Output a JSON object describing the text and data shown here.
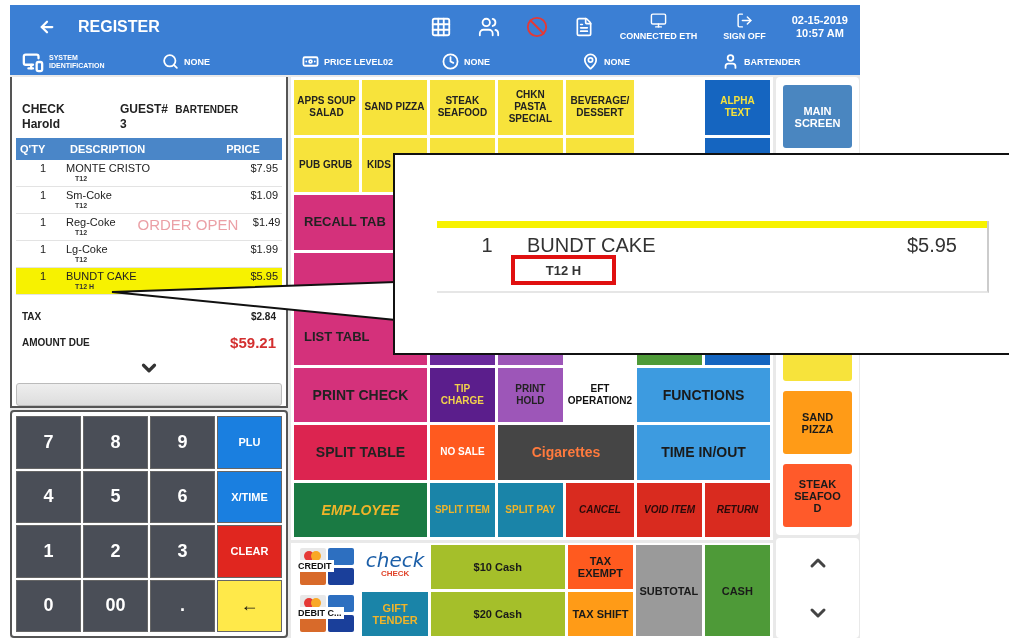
{
  "header": {
    "title": "REGISTER",
    "connection": "CONNECTED ETH",
    "sign_off": "SIGN OFF",
    "date": "02-15-2019",
    "time": "10:57 AM"
  },
  "info_bar": [
    {
      "kind": "system",
      "label": "SYSTEM IDENTIFICATION"
    },
    {
      "kind": "search",
      "label": "NONE"
    },
    {
      "kind": "price",
      "label": "PRICE LEVEL02"
    },
    {
      "kind": "clock",
      "label": "NONE"
    },
    {
      "kind": "location",
      "label": "NONE"
    },
    {
      "kind": "user",
      "label": "BARTENDER"
    }
  ],
  "check": {
    "check_label": "CHECK",
    "check_name": "Harold",
    "guest_label": "GUEST#",
    "guest_value": "3",
    "server": "BARTENDER"
  },
  "order": {
    "columns": [
      "Q'TY",
      "DESCRIPTION",
      "PRICE"
    ],
    "watermark": "ORDER OPEN",
    "rows": [
      {
        "qty": "1",
        "description": "MONTE CRISTO",
        "seat": "T12",
        "price": "$7.95",
        "selected": false
      },
      {
        "qty": "1",
        "description": "Sm-Coke",
        "seat": "T12",
        "price": "$1.09",
        "selected": false
      },
      {
        "qty": "1",
        "description": "Reg-Coke",
        "seat": "T12",
        "price": "$1.49",
        "selected": false
      },
      {
        "qty": "1",
        "description": "Lg-Coke",
        "seat": "T12",
        "price": "$1.99",
        "selected": false
      },
      {
        "qty": "1",
        "description": "BUNDT CAKE",
        "seat": "T12 H",
        "price": "$5.95",
        "selected": true
      }
    ]
  },
  "totals": {
    "tax_label": "TAX",
    "tax": "$2.84",
    "due_label": "AMOUNT DUE",
    "due": "$59.21"
  },
  "keypad": [
    {
      "kind": "digit",
      "label": "7"
    },
    {
      "kind": "digit",
      "label": "8"
    },
    {
      "kind": "digit",
      "label": "9"
    },
    {
      "kind": "function",
      "label": "PLU"
    },
    {
      "kind": "digit",
      "label": "4"
    },
    {
      "kind": "digit",
      "label": "5"
    },
    {
      "kind": "digit",
      "label": "6"
    },
    {
      "kind": "function",
      "label": "X/TIME"
    },
    {
      "kind": "digit",
      "label": "1"
    },
    {
      "kind": "digit",
      "label": "2"
    },
    {
      "kind": "digit",
      "label": "3"
    },
    {
      "kind": "clear",
      "label": "CLEAR"
    },
    {
      "kind": "digit",
      "label": "0"
    },
    {
      "kind": "digit",
      "label": "00"
    },
    {
      "kind": "digit",
      "label": "."
    },
    {
      "kind": "enter",
      "label": "←"
    }
  ],
  "menu_buttons": [
    {
      "kind": "key",
      "label": "APPS SOUP SALAD",
      "color": "#f7e33b",
      "wide": false
    },
    {
      "kind": "key",
      "label": "SAND PIZZA",
      "color": "#f7e33b",
      "wide": false
    },
    {
      "kind": "key",
      "label": "STEAK SEAFOOD",
      "color": "#f7e33b",
      "wide": false
    },
    {
      "kind": "key",
      "label": "CHKN PASTA SPECIAL",
      "color": "#f7e33b",
      "wide": false
    },
    {
      "kind": "key",
      "label": "BEVERAGE/ DESSERT",
      "color": "#f7e33b",
      "wide": false
    },
    {
      "kind": "empty"
    },
    {
      "kind": "key",
      "label": "ALPHA TEXT",
      "color": "#1565c0",
      "wide": false
    },
    {
      "kind": "key",
      "label": "PUB GRUB",
      "color": "#f7e33b",
      "wide": false
    },
    {
      "kind": "key",
      "label": "KIDS",
      "color": "#f7e33b",
      "wide": false
    },
    {
      "kind": "key",
      "color": "#f7e33b",
      "wide": false
    },
    {
      "kind": "key",
      "color": "#f7e33b",
      "wide": false
    },
    {
      "kind": "key",
      "color": "#f7e33b",
      "wide": false
    },
    {
      "kind": "empty"
    },
    {
      "kind": "key",
      "color": "#1565c0",
      "wide": false
    },
    {
      "kind": "key",
      "label": "RECALL TAB",
      "color": "#d4317b",
      "wide": true
    },
    {
      "kind": "empty"
    },
    {
      "kind": "empty"
    },
    {
      "kind": "empty"
    },
    {
      "kind": "empty"
    },
    {
      "kind": "empty"
    },
    {
      "kind": "key",
      "color": "#d4317b",
      "wide": true
    },
    {
      "kind": "empty"
    },
    {
      "kind": "empty"
    },
    {
      "kind": "empty"
    },
    {
      "kind": "empty"
    },
    {
      "kind": "empty"
    },
    {
      "kind": "key",
      "label": "LIST TABL",
      "color": "#d4317b",
      "wide": true
    },
    {
      "kind": "key",
      "color": "#6a2a9c",
      "wide": false
    },
    {
      "kind": "key",
      "color": "#9d56b8",
      "wide": false
    },
    {
      "kind": "empty"
    },
    {
      "kind": "key",
      "color": "#4e9a38",
      "wide": false
    },
    {
      "kind": "key",
      "color": "#1565c0",
      "wide": false
    },
    {
      "kind": "key",
      "label": "PRINT CHECK",
      "color": "#d4317b",
      "wide": true
    },
    {
      "kind": "key",
      "label": "TIP CHARGE",
      "color": "#5b1e8c",
      "wide": false
    },
    {
      "kind": "key",
      "label": "PRINT HOLD",
      "color": "#9d56b8",
      "wide": false
    },
    {
      "kind": "key",
      "label": "EFT OPERATION2",
      "color": "#ffffff",
      "wide": false
    },
    {
      "kind": "key",
      "label": "FUNCTIONS",
      "color": "#3d9be0",
      "wide": true
    },
    {
      "kind": "key",
      "label": "SPLIT TABLE",
      "color": "#dc2450",
      "wide": true
    },
    {
      "kind": "key",
      "label": "NO SALE",
      "color": "#ff5a1f",
      "wide": false
    },
    {
      "kind": "key",
      "label": "Cigarettes",
      "color": "#454545",
      "wide": true
    },
    {
      "kind": "key",
      "label": "TIME IN/OUT",
      "color": "#3d9be0",
      "wide": true
    },
    {
      "kind": "key",
      "label": "EMPLOYEE",
      "color": "#1a7a43",
      "wide": true
    },
    {
      "kind": "key",
      "label": "SPLIT ITEM",
      "color": "#1a84a8",
      "wide": false
    },
    {
      "kind": "key",
      "label": "SPLIT PAY",
      "color": "#1a84a8",
      "wide": false
    },
    {
      "kind": "key",
      "label": "CANCEL",
      "color": "#d92b1f",
      "wide": false
    },
    {
      "kind": "key",
      "label": "VOID ITEM",
      "color": "#d92b1f",
      "wide": false
    },
    {
      "kind": "key",
      "label": "RETURN",
      "color": "#d92b1f",
      "wide": false
    }
  ],
  "payments": [
    {
      "kind": "card",
      "label": "CREDIT"
    },
    {
      "kind": "logo",
      "label": "check",
      "caption": "CHECK"
    },
    {
      "kind": "plain",
      "label": "$10 Cash",
      "color": "#a5bf2a",
      "wide": true,
      "tall": false
    },
    {
      "kind": "plain",
      "label": "TAX EXEMPT",
      "color": "#ff5a1f",
      "wide": false,
      "tall": false
    },
    {
      "kind": "plain",
      "label": "SUBTOTAL",
      "color": "#9a9a9a",
      "wide": false,
      "tall": true
    },
    {
      "kind": "plain",
      "label": "CASH",
      "color": "#4e9a38",
      "wide": false,
      "tall": true
    },
    {
      "kind": "card",
      "label": "DEBIT C..."
    },
    {
      "kind": "plain",
      "label": "GIFT TENDER",
      "color": "#1a84a8",
      "wide": false,
      "tall": false
    },
    {
      "kind": "plain",
      "label": "$20 Cash",
      "color": "#a5bf2a",
      "wide": true,
      "tall": false
    },
    {
      "kind": "plain",
      "label": "TAX SHIFT",
      "color": "#ff9b17",
      "wide": false,
      "tall": false
    }
  ],
  "side_keys": [
    {
      "label": "MAIN SCREEN",
      "color": "#4a86c0"
    },
    {
      "color": "#f7e33b"
    },
    {
      "label": "SAND PIZZA",
      "color": "#ff9b17"
    },
    {
      "label": "STEAK SEAFOOD",
      "color": "#ff5a2a"
    }
  ],
  "callout": {
    "qty": "1",
    "description": "BUNDT CAKE",
    "seat": "T12 H",
    "price": "$5.95"
  }
}
